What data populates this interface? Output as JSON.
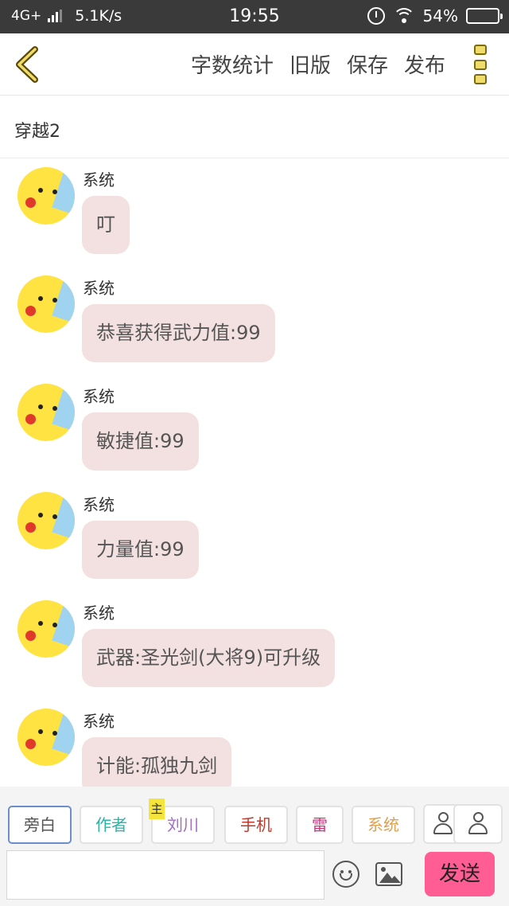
{
  "status_bar": {
    "network": "4G+",
    "speed": "5.1K/s",
    "time": "19:55",
    "battery": "54%"
  },
  "header": {
    "actions": [
      "字数统计",
      "旧版",
      "保存",
      "发布"
    ]
  },
  "story_title": "穿越2",
  "messages": [
    {
      "sender": "系统",
      "text": "叮"
    },
    {
      "sender": "系统",
      "text": "恭喜获得武力值:99"
    },
    {
      "sender": "系统",
      "text": "敏捷值:99"
    },
    {
      "sender": "系统",
      "text": "力量值:99"
    },
    {
      "sender": "系统",
      "text": "武器:圣光剑(大将9)可升级"
    },
    {
      "sender": "系统",
      "text": "计能:孤独九剑"
    }
  ],
  "roles": [
    {
      "label": "旁白",
      "color": "#555555",
      "active": true
    },
    {
      "label": "作者",
      "color": "#2bb3a6"
    },
    {
      "label": "刘川",
      "color": "#a36cc8",
      "badge": "主"
    },
    {
      "label": "手机",
      "color": "#c0392b"
    },
    {
      "label": "雷",
      "color": "#d0367c"
    },
    {
      "label": "系统",
      "color": "#e0a050"
    }
  ],
  "input": {
    "placeholder": "",
    "value": ""
  },
  "send_label": "发送",
  "colors": {
    "bubble": "#f3e0e0",
    "send_button": "#ff5d94",
    "status_bar": "#3a3a3a"
  },
  "icons": [
    "back-chevron-icon",
    "more-menu-icon",
    "emoji-icon",
    "image-icon",
    "person-icon"
  ]
}
